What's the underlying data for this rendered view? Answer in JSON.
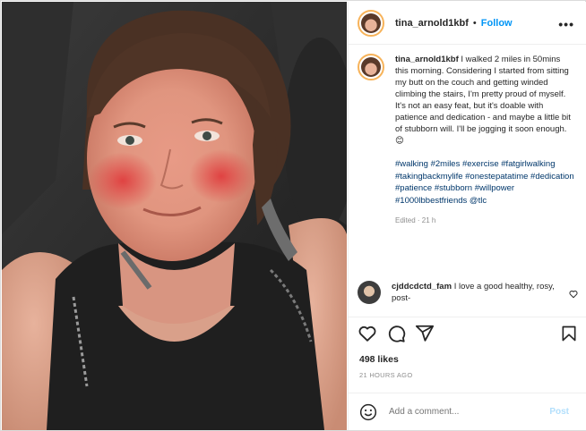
{
  "post": {
    "username": "tina_arnold1kbf",
    "separator": "•",
    "follow_label": "Follow",
    "more_label": "•••",
    "photo_alt": "Selfie of a woman with flushed cheeks sitting in a dark chair",
    "caption": {
      "username": "tina_arnold1kbf",
      "text": "I walked 2 miles in 50mins this morning. Considering I started from sitting my butt on the couch and getting winded climbing the stairs, I'm pretty proud of myself. It's not an easy feat, but it's doable with patience and dedication - and maybe a little bit of stubborn will. I'll be jogging it soon enough. 😊",
      "hashtags": "#walking #2miles #exercise #fatgirlwalking #takingbackmylife #onestepatatime #dedication #patience #stubborn #willpower #1000lbbestfriends @tlc",
      "edited": "Edited · 21 h"
    },
    "comment": {
      "username": "cjddcdctd_fam",
      "text": "I love a good healthy, rosy, post-"
    },
    "likes": "498 likes",
    "timestamp": "21 HOURS AGO",
    "add_comment_placeholder": "Add a comment...",
    "post_button": "Post"
  },
  "icons": {
    "more": "more-options-icon",
    "like": "heart-icon",
    "comment": "comment-icon",
    "share": "share-icon",
    "save": "bookmark-icon",
    "comment_like": "small-heart-icon",
    "emoji": "emoji-icon"
  },
  "colors": {
    "link": "#00376b",
    "follow": "#0095f6",
    "muted": "#8e8e8e",
    "post_disabled": "#b2dffc",
    "story_ring": "#f7b35a"
  }
}
